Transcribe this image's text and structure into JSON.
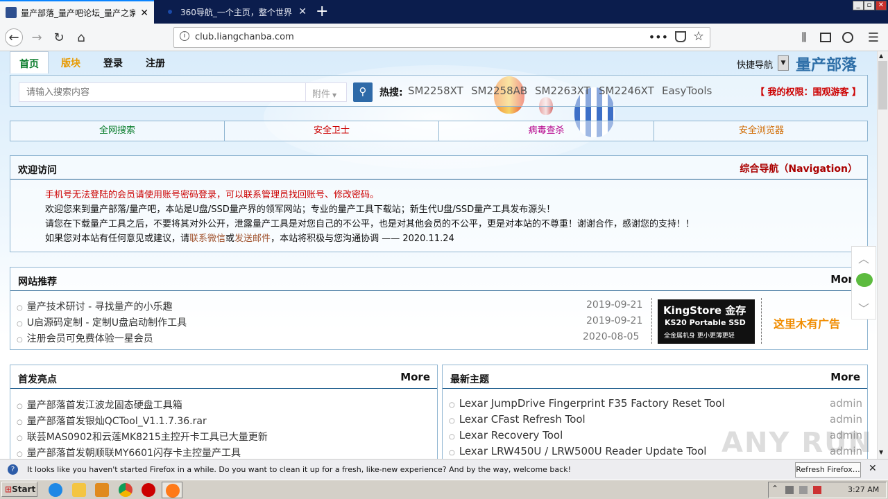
{
  "browser": {
    "tabs": [
      {
        "title": "量产部落_量产吧论坛_量产之家_",
        "active": true
      },
      {
        "title": "360导航_一个主页，整个世界",
        "active": false
      }
    ],
    "new_tab": "+",
    "url": "club.liangchanba.com",
    "window_buttons": [
      "_",
      "▫",
      "✕"
    ]
  },
  "site": {
    "nav": [
      "首页",
      "版块",
      "登录",
      "注册"
    ],
    "quick_nav": "快捷导航",
    "logo": "量产部落",
    "search_placeholder": "请输入搜索内容",
    "search_scope": "附件",
    "hot_label": "热搜:",
    "hot_terms": [
      "SM2258XT",
      "SM2258AB",
      "SM2263XT",
      "SM2246XT",
      "EasyTools"
    ],
    "permission": "【 我的权限：围观游客 】",
    "link_bar": [
      "全网搜索",
      "安全卫士",
      "病毒查杀",
      "安全浏览器"
    ],
    "welcome": {
      "title": "欢迎访问",
      "nav_link": "综合导航（Navigation）",
      "notice_red": "手机号无法登陆的会员请使用账号密码登录，可以联系管理员找回账号、修改密码。",
      "line2": "欢迎您来到量产部落/量产吧，本站是U盘/SSD量产界的领军网站；专业的量产工具下载站；新生代U盘/SSD量产工具发布源头！",
      "line3": "请您在下载量产工具之后，不要将其对外公开，泄露量产工具是对您自己的不公平，也是对其他会员的不公平，更是对本站的不尊重！谢谢合作，感谢您的支持！！",
      "line4_a": "如果您对本站有任何意见或建议，请",
      "line4_link1": "联系微信",
      "line4_or": "或",
      "line4_link2": "发送邮件",
      "line4_b": "，本站将积极与您沟通协调 —— 2020.11.24"
    },
    "recommend": {
      "title": "网站推荐",
      "more": "More",
      "items": [
        {
          "text": "量产技术研讨 - 寻找量产的小乐趣",
          "date": "2019-09-21"
        },
        {
          "text": "U启源码定制 - 定制U盘启动制作工具",
          "date": "2019-09-21"
        },
        {
          "text": "注册会员可免费体验一星会员",
          "date": "2020-08-05"
        }
      ],
      "ad_brand": "KingStore 金存",
      "ad_model": "KS20 Portable SSD",
      "ad_slogan": "全金属机身 更小更薄更轻",
      "ad_empty": "这里木有广告"
    },
    "first_release": {
      "title": "首发亮点",
      "more": "More",
      "items": [
        "量产部落首发江波龙固态硬盘工具箱",
        "量产部落首发银灿QCTool_V1.1.7.36.rar",
        "联芸MAS0902和云莲MK8215主控开卡工具已大量更新",
        "量产部落首发朝顺联MY6601闪存卡主控量产工具"
      ]
    },
    "latest": {
      "title": "最新主题",
      "more": "More",
      "items": [
        {
          "text": "Lexar JumpDrive Fingerprint F35 Factory Reset Tool",
          "author": "admin"
        },
        {
          "text": "Lexar CFast Refresh Tool",
          "author": "admin"
        },
        {
          "text": "Lexar Recovery Tool",
          "author": "admin"
        },
        {
          "text": "Lexar LRW450U / LRW500U Reader Update Tool",
          "author": "admin"
        }
      ]
    }
  },
  "notification": {
    "message": "It looks like you haven't started Firefox in a while. Do you want to clean it up for a fresh, like-new experience? And by the way, welcome back!",
    "button": "Refresh Firefox…"
  },
  "taskbar": {
    "start": "Start",
    "clock": "3:27 AM"
  },
  "watermark": "ANY RUN"
}
